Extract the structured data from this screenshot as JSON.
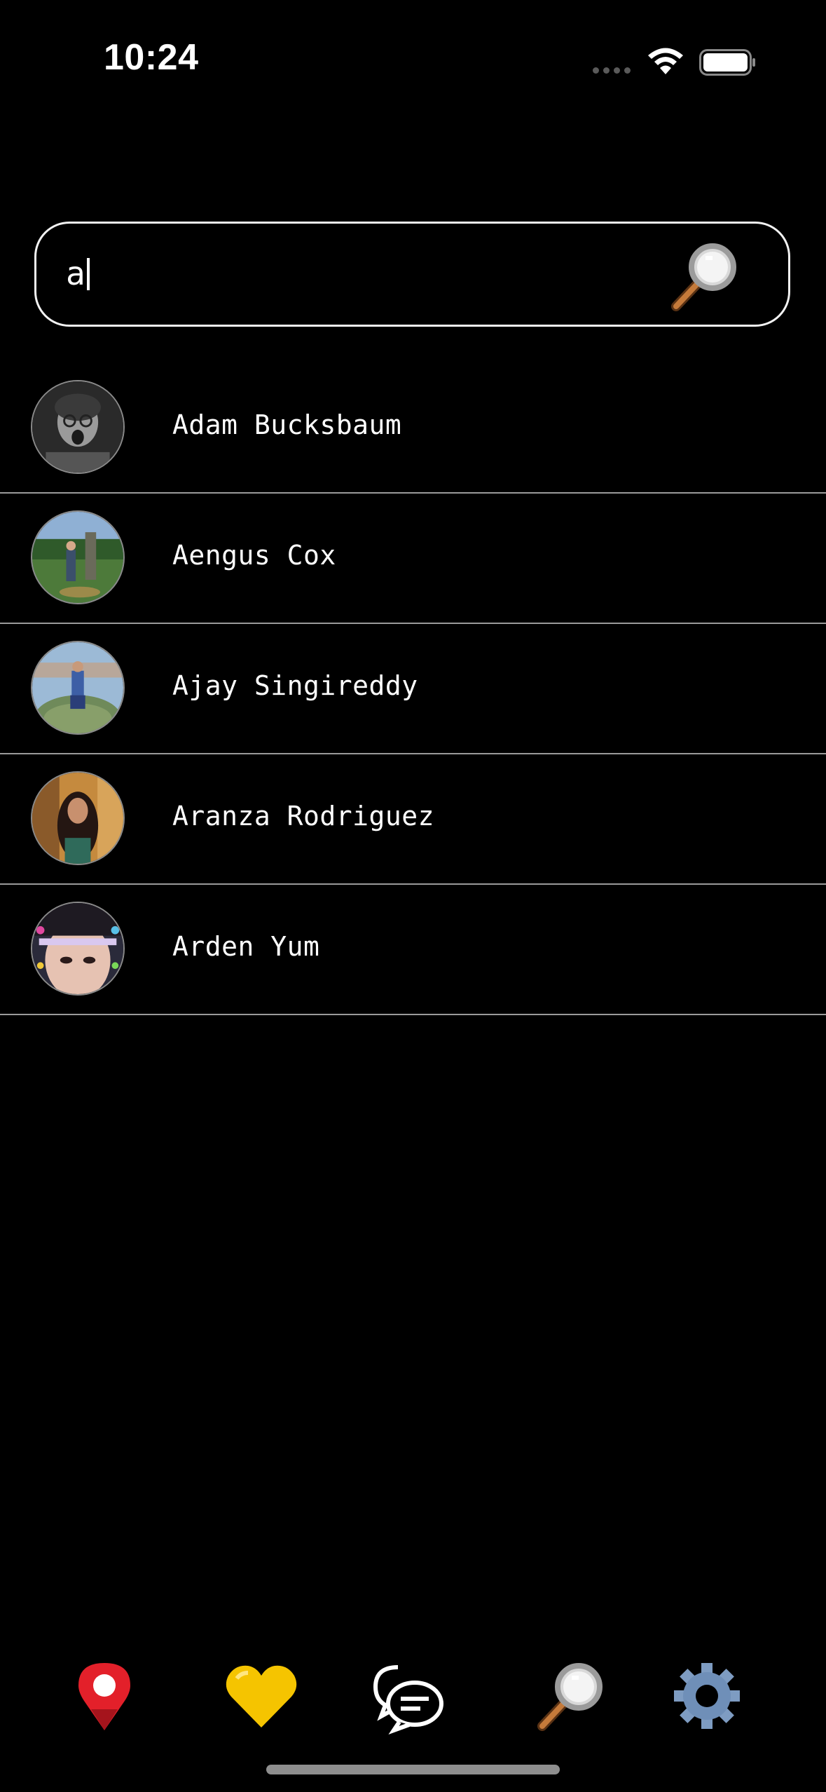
{
  "status_bar": {
    "time": "10:24"
  },
  "search": {
    "value": "a"
  },
  "results": [
    {
      "name": "Adam Bucksbaum"
    },
    {
      "name": "Aengus Cox"
    },
    {
      "name": "Ajay Singireddy"
    },
    {
      "name": "Aranza Rodriguez"
    },
    {
      "name": "Arden Yum"
    }
  ],
  "tab_bar": {
    "items": [
      {
        "icon": "map-pin-icon"
      },
      {
        "icon": "heart-icon"
      },
      {
        "icon": "chat-icon"
      },
      {
        "icon": "search-icon"
      },
      {
        "icon": "gear-icon"
      }
    ]
  },
  "colors": {
    "background": "#000000",
    "text": "#ffffff",
    "divider": "#9a9a9a",
    "pin_red": "#e3202a",
    "heart_yellow": "#f5c400",
    "gear_blue": "#7e9cc2"
  }
}
